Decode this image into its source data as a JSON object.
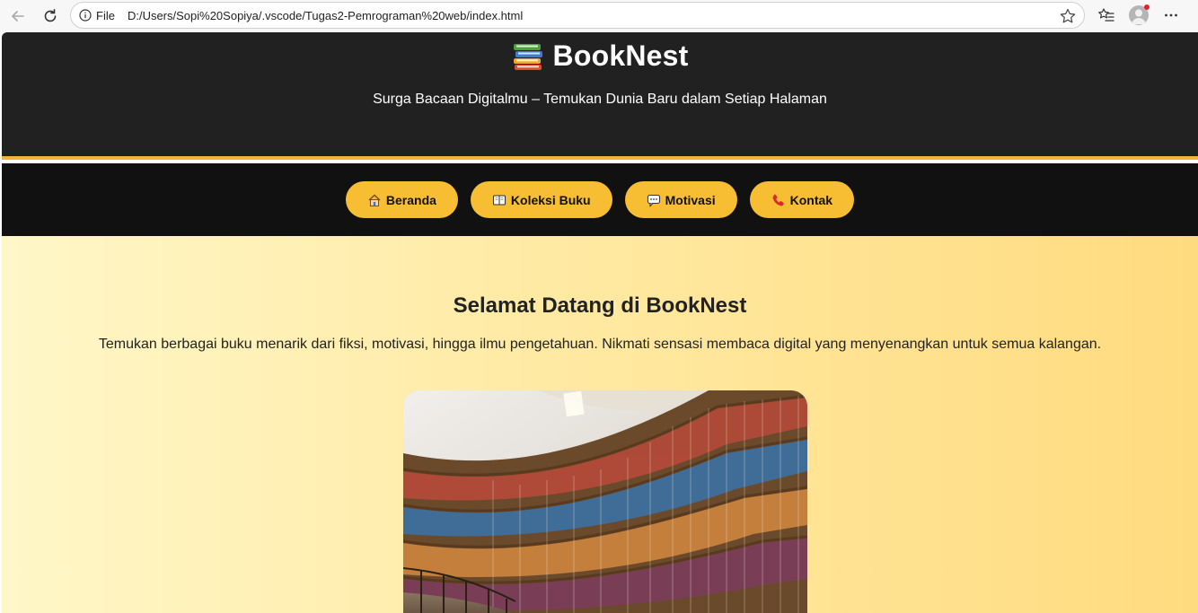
{
  "browser": {
    "file_label": "File",
    "url": "D:/Users/Sopi%20Sopiya/.vscode/Tugas2-Pemrograman%20web/index.html",
    "icons": [
      "back-icon",
      "reload-icon",
      "info-icon",
      "star-icon",
      "favorites-icon",
      "profile-icon",
      "more-icon"
    ]
  },
  "header": {
    "title": "BookNest",
    "tagline": "Surga Bacaan Digitalmu – Temukan Dunia Baru dalam Setiap Halaman",
    "accent_color": "#f3b43a"
  },
  "nav": {
    "items": [
      {
        "label": "Beranda",
        "icon": "house-icon"
      },
      {
        "label": "Koleksi Buku",
        "icon": "book-icon"
      },
      {
        "label": "Motivasi",
        "icon": "speech-bubble-icon"
      },
      {
        "label": "Kontak",
        "icon": "phone-icon"
      }
    ],
    "pill_color": "#f7bd33"
  },
  "main": {
    "welcome": "Selamat Datang di BookNest",
    "intro": "Temukan berbagai buku menarik dari fiksi, motivasi, hingga ilmu pengetahuan. Nikmati sensasi membaca digital yang menyenangkan untuk semua kalangan."
  }
}
